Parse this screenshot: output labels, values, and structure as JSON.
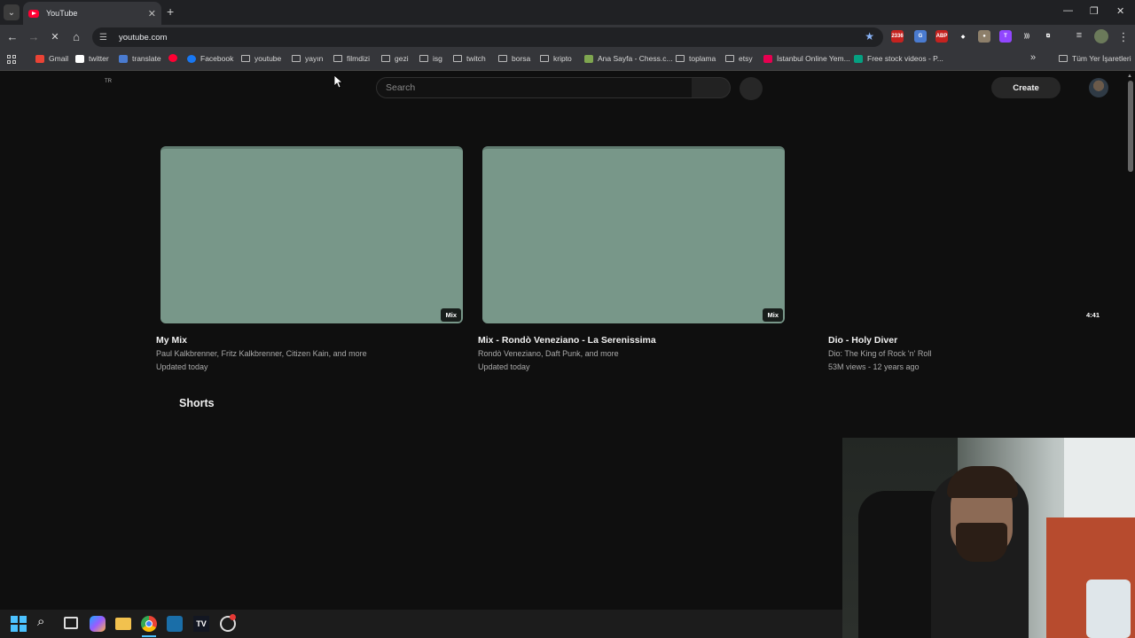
{
  "browser": {
    "tab": {
      "title": "YouTube",
      "close": "✕"
    },
    "new_tab": "+",
    "window_controls": {
      "minimize": "—",
      "restore": "❐",
      "close": "✕"
    },
    "toolbar": {
      "back": "←",
      "forward": "→",
      "reload": "✕",
      "home": "⌂",
      "url": "youtube.com",
      "bookmark_star": "★",
      "extensions": [
        {
          "name": "ext-badge",
          "label": "2336",
          "color": "#c5221f"
        },
        {
          "name": "ext-translate",
          "label": "G",
          "color": "#4a7bd0"
        },
        {
          "name": "ext-abp",
          "label": "ABP",
          "color": "#c5221f"
        },
        {
          "name": "ext-diamond",
          "label": "◆",
          "color": "#35363a"
        },
        {
          "name": "ext-circle",
          "label": "●",
          "color": "#8d7f6a"
        },
        {
          "name": "ext-twitch",
          "label": "T",
          "color": "#9146ff"
        },
        {
          "name": "ext-wave",
          "label": ")))",
          "color": "#35363a"
        },
        {
          "name": "ext-puzzle",
          "label": "⧉",
          "color": "#35363a"
        }
      ]
    },
    "bookmarks": [
      {
        "label": "Gmail",
        "icon": "gmail"
      },
      {
        "label": "twitter",
        "icon": "x"
      },
      {
        "label": "translate",
        "icon": "translate"
      },
      {
        "label": "",
        "icon": "youtube"
      },
      {
        "label": "Facebook",
        "icon": "facebook"
      },
      {
        "label": "youtube",
        "icon": "folder"
      },
      {
        "label": "yayın",
        "icon": "folder"
      },
      {
        "label": "filmdizi",
        "icon": "folder"
      },
      {
        "label": "gezi",
        "icon": "folder"
      },
      {
        "label": "isg",
        "icon": "folder"
      },
      {
        "label": "twitch",
        "icon": "folder"
      },
      {
        "label": "borsa",
        "icon": "folder"
      },
      {
        "label": "kripto",
        "icon": "folder"
      },
      {
        "label": "Ana Sayfa - Chess.c...",
        "icon": "chess"
      },
      {
        "label": "toplama",
        "icon": "folder"
      },
      {
        "label": "etsy",
        "icon": "folder"
      },
      {
        "label": "İstanbul Online Yem...",
        "icon": "yemek"
      },
      {
        "label": "Free stock videos - P...",
        "icon": "pexels"
      }
    ],
    "bookmarks_overflow": "»",
    "all_bookmarks": "Tüm Yer İşaretleri"
  },
  "youtube": {
    "country_code": "TR",
    "search_placeholder": "Search",
    "create_label": "Create",
    "videos": [
      {
        "title": "My Mix",
        "channel": "Paul Kalkbrenner, Fritz Kalkbrenner, Citizen Kain, and more",
        "meta": "Updated today",
        "badge": "Mix"
      },
      {
        "title": "Mix - Rondò Veneziano - La Serenissima",
        "channel": "Rondò Veneziano, Daft Punk, and more",
        "meta": "Updated today",
        "badge": "Mix"
      },
      {
        "title": "Dio - Holy Diver",
        "channel": "Dio: The King of Rock 'n' Roll",
        "meta": "53M views - 12 years ago",
        "badge": "4:41"
      }
    ],
    "shorts_heading": "Shorts"
  },
  "taskbar": {
    "icons": [
      "windows-start",
      "search",
      "task-view",
      "copilot",
      "file-explorer",
      "chrome",
      "app-blue",
      "tradingview",
      "recorder"
    ]
  },
  "colors": {
    "thumbnail": "#789789",
    "page_bg": "#0f0f0f",
    "chrome_toolbar": "#35363a"
  }
}
